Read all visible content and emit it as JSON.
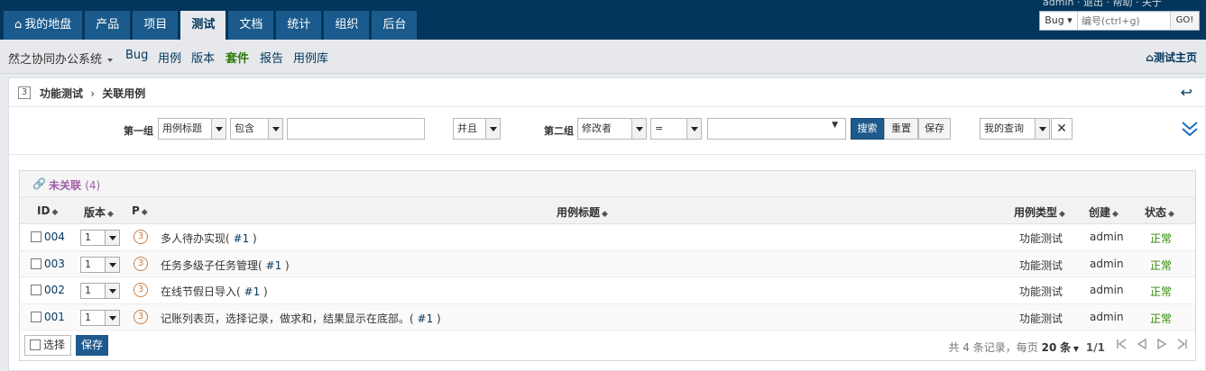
{
  "colors": {
    "nav_bg": "#03365c",
    "nav_item": "#1a5a8c",
    "accent": "#1f5a8c",
    "link": "#03365c",
    "active_green": "#2e7d0a",
    "status_green": "#2e8b00",
    "purple": "#a35ba8",
    "priority": "#c9814a"
  },
  "topnav": {
    "items": [
      {
        "label": "我的地盘",
        "icon": "home-icon"
      },
      {
        "label": "产品"
      },
      {
        "label": "项目"
      },
      {
        "label": "测试"
      },
      {
        "label": "文档"
      },
      {
        "label": "统计"
      },
      {
        "label": "组织"
      },
      {
        "label": "后台"
      }
    ],
    "active": "测试"
  },
  "topright": {
    "links": "admin · 退出 · 帮助 · 关于",
    "search": {
      "type_label": "Bug",
      "placeholder": "编号(ctrl+g)",
      "go_label": "GO!"
    }
  },
  "subnav": {
    "product": "然之协同办公系统",
    "items": [
      "Bug",
      "用例",
      "版本",
      "套件",
      "报告",
      "用例库"
    ],
    "active": "套件",
    "home_link": "测试主页"
  },
  "titlebar": {
    "badge": "3",
    "suite": "功能测试",
    "separator": "›",
    "page": "关联用例"
  },
  "search_form": {
    "group1_label": "第一组",
    "group1_field": "用例标题",
    "group1_operator": "包含",
    "group1_value": "",
    "logic": "并且",
    "group2_label": "第二组",
    "group2_field": "修改者",
    "group2_operator": "=",
    "group2_value": "",
    "search_btn": "搜索",
    "reset_btn": "重置",
    "save_btn": "保存",
    "my_query": "我的查询"
  },
  "table": {
    "title": "未关联",
    "count": "(4)",
    "headers": {
      "id": "ID",
      "version": "版本",
      "priority": "P",
      "title": "用例标题",
      "type": "用例类型",
      "creator": "创建",
      "status": "状态"
    },
    "rows": [
      {
        "id": "004",
        "version": "1",
        "priority": "3",
        "title": "多人待办实现",
        "ref": "#1",
        "type": "功能测试",
        "creator": "admin",
        "status": "正常"
      },
      {
        "id": "003",
        "version": "1",
        "priority": "3",
        "title": "任务多级子任务管理",
        "ref": "#1",
        "type": "功能测试",
        "creator": "admin",
        "status": "正常"
      },
      {
        "id": "002",
        "version": "1",
        "priority": "3",
        "title": "在线节假日导入",
        "ref": "#1",
        "type": "功能测试",
        "creator": "admin",
        "status": "正常"
      },
      {
        "id": "001",
        "version": "1",
        "priority": "3",
        "title": "记账列表页，选择记录，做求和，结果显示在底部。",
        "ref": "#1",
        "type": "功能测试",
        "creator": "admin",
        "status": "正常"
      }
    ],
    "footer": {
      "select_all": "选择",
      "save": "保存",
      "total_prefix": "共",
      "total": "4",
      "total_suffix": "条记录，每页",
      "per_page": "20",
      "per_page_suffix": "条",
      "page": "1/1"
    }
  }
}
